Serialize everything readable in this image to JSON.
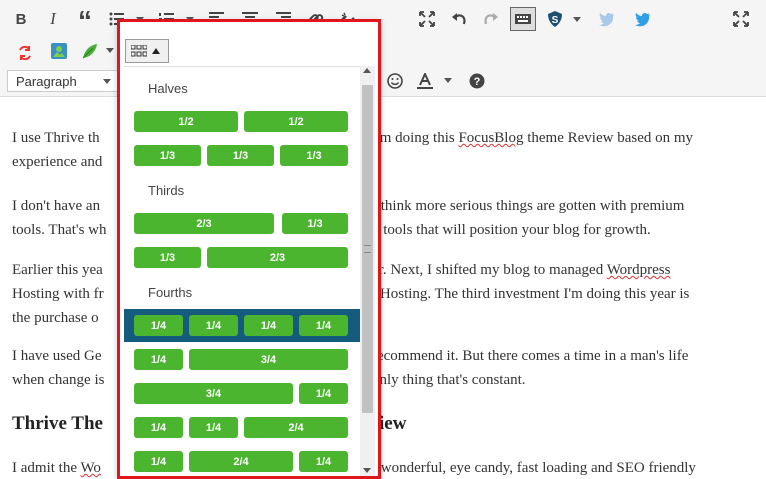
{
  "toolbar": {
    "format_value": "Paragraph",
    "icons_row1": [
      "bold-icon",
      "italic-icon",
      "blockquote-icon",
      "bullet-list-icon",
      "numbered-list-icon",
      "align-left-icon",
      "align-center-icon",
      "align-right-icon",
      "link-icon",
      "unlink-icon",
      "table-icon",
      "fullscreen-icon",
      "undo-icon",
      "redo-icon",
      "keyboard-icon",
      "shield-icon",
      "bird-icon",
      "twitter-icon",
      "expand-icon"
    ],
    "bold": "B",
    "italic": "I",
    "quote": "“",
    "help": "?"
  },
  "dropdown": {
    "groups": [
      {
        "label": "Halves"
      },
      {
        "label": "Thirds"
      },
      {
        "label": "Fourths"
      }
    ],
    "rows": [
      [
        "1/2",
        "1/2"
      ],
      [
        "1/3",
        "1/3",
        "1/3"
      ],
      [
        "2/3",
        "1/3"
      ],
      [
        "1/3",
        "2/3"
      ],
      [
        "1/4",
        "1/4",
        "1/4",
        "1/4"
      ],
      [
        "1/4",
        "3/4"
      ],
      [
        "3/4",
        "1/4"
      ],
      [
        "1/4",
        "1/4",
        "2/4"
      ],
      [
        "1/4",
        "2/4",
        "1/4"
      ]
    ]
  },
  "content": {
    "p1a": "I use Thrive th",
    "p1b": "I'm doing this FocusBlog theme Review based on my",
    "p1c": "experience and",
    "p2a": "I don't have an",
    "p2b": "I think more serious things are gotten with premium",
    "p2c": "tools. That's wh",
    "p2d": "n tools that will position your blog for growth.",
    "p3a": "Earlier this yea",
    "p3b": "er. Next, I shifted my blog to managed Wordpress",
    "p3c": "Hosting with fr",
    "p3d": "t Hosting. The third investment I'm doing this year is",
    "p3e": "the purchase o",
    "p4a": "I have used Ge",
    "p4b": "recommend it. But there comes a time in a man's life",
    "p4c": "when change is",
    "p4d": "only thing that's constant.",
    "heading_a": "Thrive The",
    "heading_b": "iew",
    "p5a": "I admit the Wo",
    "p5b": "f wonderful, eye candy, fast loading and SEO friendly"
  }
}
